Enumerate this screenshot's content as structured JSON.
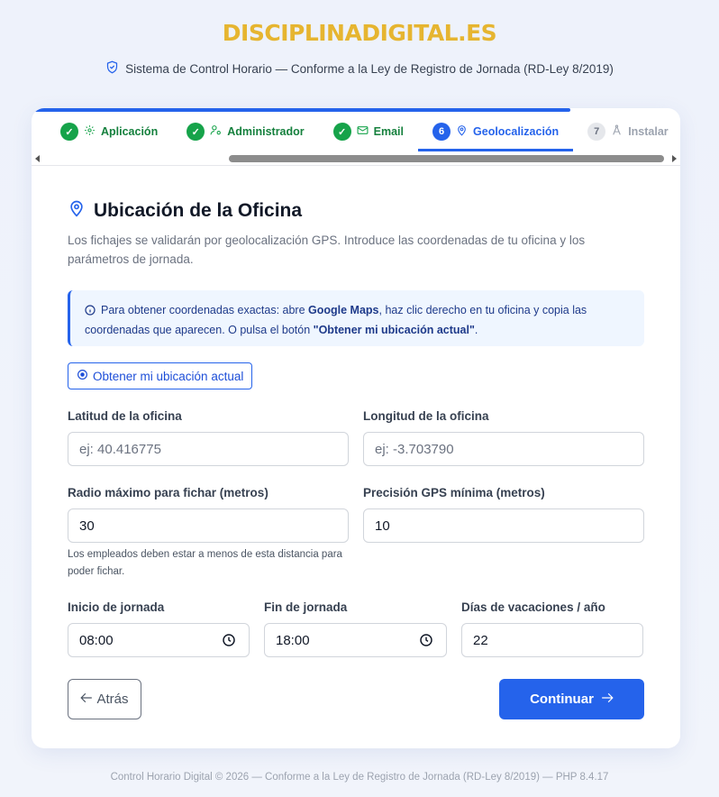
{
  "brand": {
    "logo_text": "DISCIPLINADIGITAL.ES",
    "logo_color": "#e6b530"
  },
  "header": {
    "subtitle": "Sistema de Control Horario — Conforme a la Ley de Registro de Jornada (RD-Ley 8/2019)",
    "icon": "shield-check-icon"
  },
  "wizard": {
    "progress": 0.83,
    "accent_color": "#2563eb",
    "steps": [
      {
        "label": "Aplicación",
        "status": "done",
        "icon": "gear-icon"
      },
      {
        "label": "Administrador",
        "status": "done",
        "icon": "user-gear-icon"
      },
      {
        "label": "Email",
        "status": "done",
        "icon": "envelope-icon"
      },
      {
        "number": "6",
        "label": "Geolocalización",
        "status": "active",
        "icon": "map-pin-icon"
      },
      {
        "number": "7",
        "label": "Instalar",
        "status": "todo",
        "icon": "compass-icon"
      }
    ]
  },
  "section": {
    "title": "Ubicación de la Oficina",
    "description": "Los fichajes se validarán por geolocalización GPS. Introduce las coordenadas de tu oficina y los parámetros de jornada."
  },
  "info": {
    "text_1": "Para obtener coordenadas exactas: abre ",
    "bold_1": "Google Maps",
    "text_2": ", haz clic derecho en tu oficina y copia las coordenadas que aparecen. O pulsa el botón ",
    "bold_2": "\"Obtener mi ubicación actual\"",
    "text_3": "."
  },
  "locate_button": {
    "label": "Obtener mi ubicación actual"
  },
  "form": {
    "lat": {
      "label": "Latitud de la oficina",
      "value": "",
      "placeholder": "ej: 40.416775"
    },
    "lng": {
      "label": "Longitud de la oficina",
      "value": "",
      "placeholder": "ej: -3.703790"
    },
    "radius": {
      "label": "Radio máximo para fichar (metros)",
      "value": "30",
      "help": "Los empleados deben estar a menos de esta distancia para poder fichar."
    },
    "precision": {
      "label": "Precisión GPS mínima (metros)",
      "value": "10"
    },
    "start": {
      "label": "Inicio de jornada",
      "value": "08:00"
    },
    "end": {
      "label": "Fin de jornada",
      "value": "18:00"
    },
    "vacation": {
      "label": "Días de vacaciones / año",
      "value": "22"
    }
  },
  "nav": {
    "back_label": "Atrás",
    "next_label": "Continuar"
  },
  "footer": {
    "text": "Control Horario Digital © 2026 — Conforme a la Ley de Registro de Jornada (RD-Ley 8/2019) — PHP 8.4.17"
  }
}
